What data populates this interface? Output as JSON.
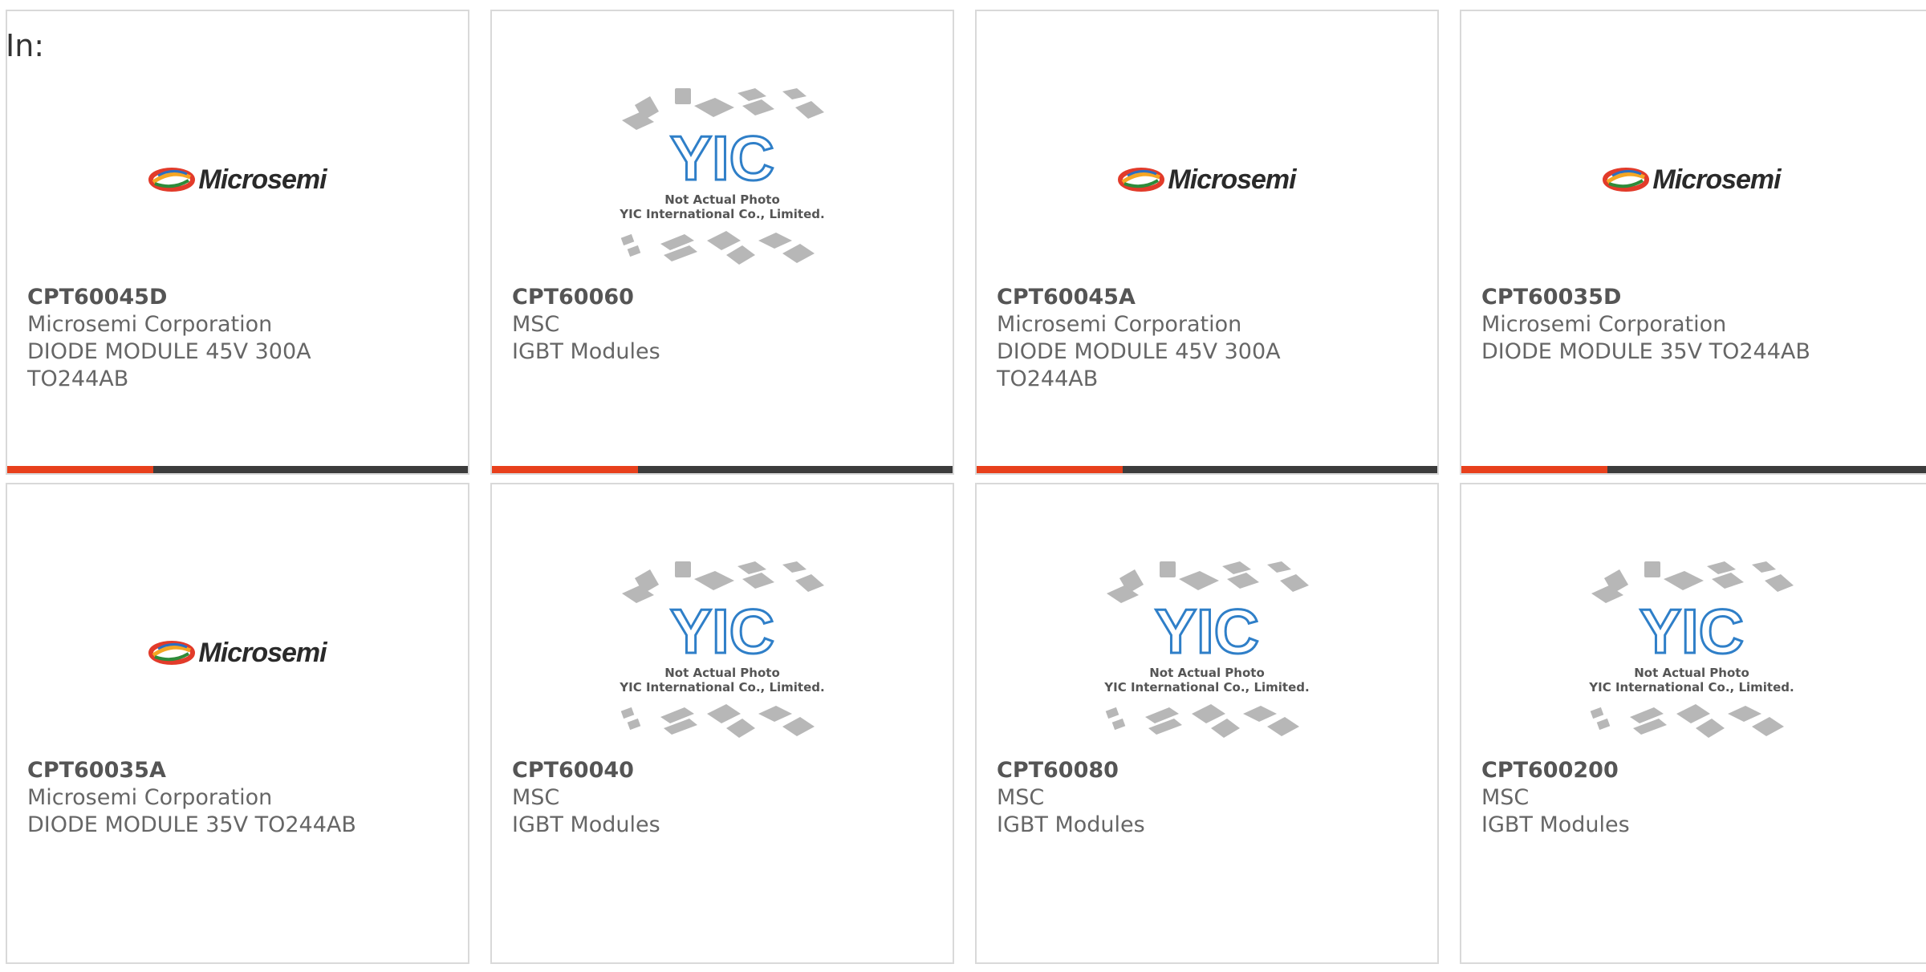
{
  "header": {
    "in_label": "In:"
  },
  "logos": {
    "microsemi_word": "Microsemi",
    "yic_mark": "YIC",
    "yic_line1": "Not Actual Photo",
    "yic_line2": "YIC International Co., Limited."
  },
  "colors": {
    "accent": "#e8401c",
    "bar": "#3c3c3c",
    "border": "#d9d9d9",
    "yic_blue": "#2f7fc8"
  },
  "products": [
    {
      "part": "CPT60045D",
      "maker": "Microsemi Corporation",
      "desc": "DIODE MODULE 45V 300A",
      "desc2": "TO244AB",
      "image": "microsemi-logo"
    },
    {
      "part": "CPT60060",
      "maker": "MSC",
      "desc": "IGBT Modules",
      "desc2": "",
      "image": "yic-placeholder"
    },
    {
      "part": "CPT60045A",
      "maker": "Microsemi Corporation",
      "desc": "DIODE MODULE 45V 300A",
      "desc2": "TO244AB",
      "image": "microsemi-logo"
    },
    {
      "part": "CPT60035D",
      "maker": "Microsemi Corporation",
      "desc": "DIODE MODULE 35V TO244AB",
      "desc2": "",
      "image": "microsemi-logo"
    },
    {
      "part": "CPT60035A",
      "maker": "Microsemi Corporation",
      "desc": "DIODE MODULE 35V TO244AB",
      "desc2": "",
      "image": "microsemi-logo"
    },
    {
      "part": "CPT60040",
      "maker": "MSC",
      "desc": "IGBT Modules",
      "desc2": "",
      "image": "yic-placeholder"
    },
    {
      "part": "CPT60080",
      "maker": "MSC",
      "desc": "IGBT Modules",
      "desc2": "",
      "image": "yic-placeholder"
    },
    {
      "part": "CPT600200",
      "maker": "MSC",
      "desc": "IGBT Modules",
      "desc2": "",
      "image": "yic-placeholder"
    }
  ]
}
